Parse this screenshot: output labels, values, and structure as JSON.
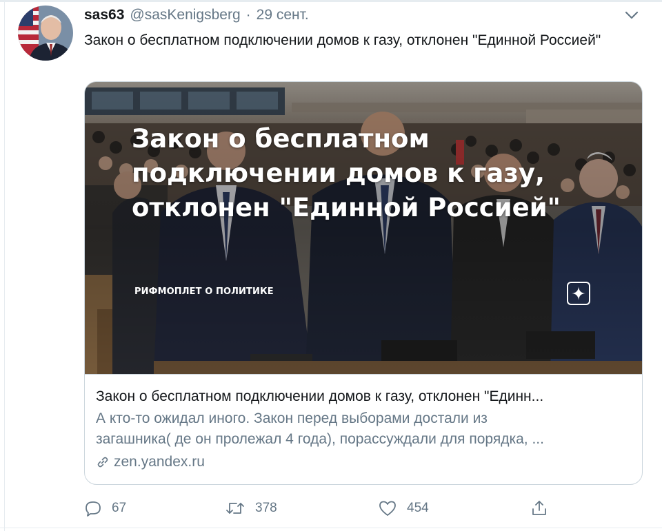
{
  "tweet": {
    "author_name": "sas63",
    "author_handle": "@sasKenigsberg",
    "separator": "·",
    "date": "29 сент.",
    "text": "Закон о бесплатном подключении домов к газу, отклонен \"Единной Россией\""
  },
  "card": {
    "image_headline_lines": [
      "Закон о бесплатном",
      "подключении домов к газу,",
      "отклонен \"Единной Россией\""
    ],
    "image_source_label": "РИФМОПЛЕТ О ПОЛИТИКЕ",
    "title": "Закон о бесплатном подключении домов к газу, отклонен \"Единн...",
    "description_lines": [
      "А кто-то ожидал иного. Закон перед выборами достали из",
      "загашника( де он пролежал 4 года), порассуждали для порядка, ..."
    ],
    "domain": "zen.yandex.ru"
  },
  "actions": {
    "reply_count": "67",
    "retweet_count": "378",
    "like_count": "454"
  },
  "icons": {
    "caret": "chevron-down-icon",
    "link": "link-icon",
    "reply": "reply-icon",
    "retweet": "retweet-icon",
    "like": "heart-icon",
    "share": "share-icon",
    "zen": "zen-logo-icon"
  },
  "colors": {
    "text_primary": "#14171a",
    "text_secondary": "#657786",
    "border": "#ccd6dd"
  }
}
